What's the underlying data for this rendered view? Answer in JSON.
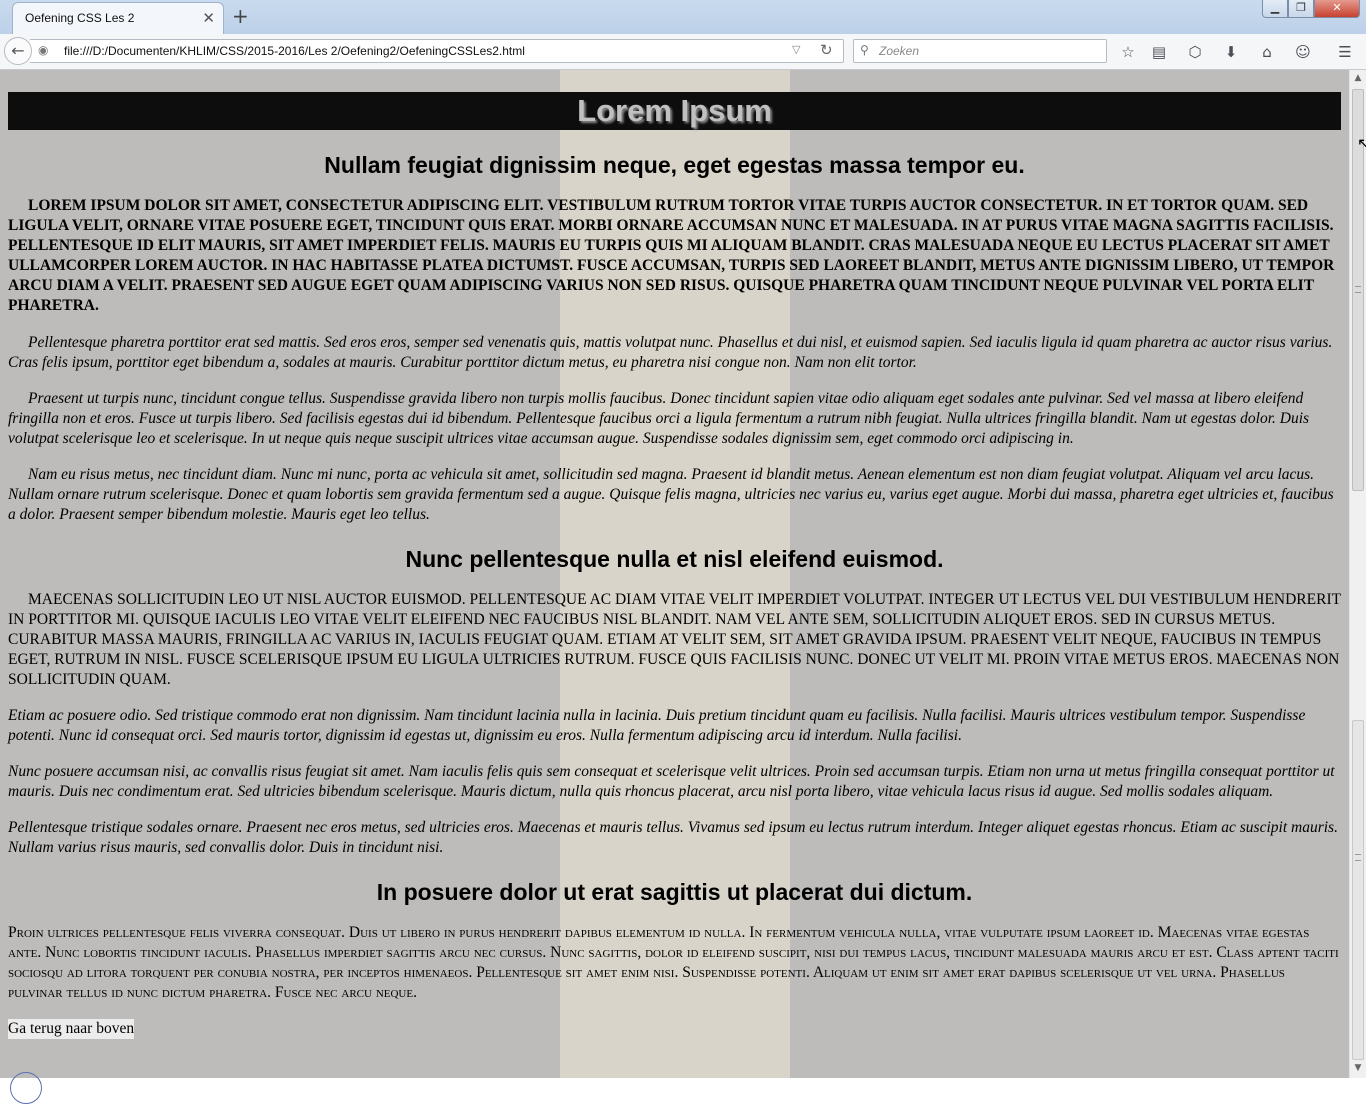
{
  "browser": {
    "tab_title": "Oefening CSS Les 2",
    "tab_close": "✕",
    "new_tab": "+",
    "window_minimize": "▁",
    "window_maximize": "❐",
    "window_close": "✕",
    "back_icon": "←",
    "site_icon": "◉",
    "url": "file:///D:/Documenten/KHLIM/CSS/2015-2016/Les 2/Oefening2/OefeningCSSLes2.html",
    "url_dropdown_icon": "▽",
    "reload_icon": "↻",
    "search_icon": "⚲",
    "search_placeholder": "Zoeken",
    "toolbar_icons": {
      "bookmark": "☆",
      "reading_list": "▤",
      "pocket": "⬡",
      "downloads": "⬇",
      "home": "⌂",
      "chat": "☺",
      "menu": "☰"
    }
  },
  "page": {
    "banner_title": "Lorem Ipsum",
    "section1": {
      "heading": "Nullam feugiat dignissim neque, eget egestas massa tempor eu.",
      "p1": "Lorem ipsum dolor sit amet, consectetur adipiscing elit. Vestibulum rutrum tortor vitae turpis auctor consectetur. In et tortor quam. Sed ligula velit, ornare vitae posuere eget, tincidunt quis erat. Morbi ornare accumsan nunc et malesuada. In at purus vitae magna sagittis facilisis. Pellentesque id elit mauris, sit amet imperdiet felis. Mauris eu turpis quis mi aliquam blandit. Cras malesuada neque eu lectus placerat sit amet ullamcorper lorem auctor. In hac habitasse platea dictumst. Fusce accumsan, turpis sed laoreet blandit, metus ante dignissim libero, ut tempor arcu diam a velit. Praesent sed augue eget quam adipiscing varius non sed risus. Quisque pharetra quam tincidunt neque pulvinar vel porta elit pharetra.",
      "p2": "Pellentesque pharetra porttitor erat sed mattis. Sed eros eros, semper sed venenatis quis, mattis volutpat nunc. Phasellus et dui nisl, et euismod sapien. Sed iaculis ligula id quam pharetra ac auctor risus varius. Cras felis ipsum, porttitor eget bibendum a, sodales at mauris. Curabitur porttitor dictum metus, eu pharetra nisi congue non. Nam non elit tortor.",
      "p3": "Praesent ut turpis nunc, tincidunt congue tellus. Suspendisse gravida libero non turpis mollis faucibus. Donec tincidunt sapien vitae odio aliquam eget sodales ante pulvinar. Sed vel massa at libero eleifend fringilla non et eros. Fusce ut turpis libero. Sed facilisis egestas dui id bibendum. Pellentesque faucibus orci a ligula fermentum a rutrum nibh feugiat. Nulla ultrices fringilla blandit. Nam ut egestas dolor. Duis volutpat scelerisque leo et scelerisque. In ut neque quis neque suscipit ultrices vitae accumsan augue. Suspendisse sodales dignissim sem, eget commodo orci adipiscing in.",
      "p4": "Nam eu risus metus, nec tincidunt diam. Nunc mi nunc, porta ac vehicula sit amet, sollicitudin sed magna. Praesent id blandit metus. Aenean elementum est non diam feugiat volutpat. Aliquam vel arcu lacus. Nullam ornare rutrum scelerisque. Donec et quam lobortis sem gravida fermentum sed a augue. Quisque felis magna, ultricies nec varius eu, varius eget augue. Morbi dui massa, pharetra eget ultricies et, faucibus a dolor. Praesent semper bibendum molestie. Mauris eget leo tellus."
    },
    "section2": {
      "heading": "Nunc pellentesque nulla et nisl eleifend euismod.",
      "p1": "Maecenas sollicitudin leo ut nisl auctor euismod. Pellentesque ac diam vitae velit imperdiet volutpat. Integer ut lectus vel dui vestibulum hendrerit in porttitor mi. Quisque iaculis leo vitae velit eleifend nec faucibus nisl blandit. Nam vel ante sem, sollicitudin aliquet eros. Sed in cursus metus. Curabitur massa mauris, fringilla ac varius in, iaculis feugiat quam. Etiam at velit sem, sit amet gravida ipsum. Praesent velit neque, faucibus in tempus eget, rutrum in nisl. Fusce scelerisque ipsum eu ligula ultricies rutrum. Fusce quis facilisis nunc. Donec ut velit mi. Proin vitae metus eros. Maecenas non sollicitudin quam.",
      "p2": "Etiam ac posuere odio. Sed tristique commodo erat non dignissim. Nam tincidunt lacinia nulla in lacinia. Duis pretium tincidunt quam eu facilisis. Nulla facilisi. Mauris ultrices vestibulum tempor. Suspendisse potenti. Nunc id consequat orci. Sed mauris tortor, dignissim id egestas ut, dignissim eu eros. Nulla fermentum adipiscing arcu id interdum. Nulla facilisi.",
      "p3": "Nunc posuere accumsan nisi, ac convallis risus feugiat sit amet. Nam iaculis felis quis sem consequat et scelerisque velit ultrices. Proin sed accumsan turpis. Etiam non urna ut metus fringilla consequat porttitor ut mauris. Duis nec condimentum erat. Sed ultricies bibendum scelerisque. Mauris dictum, nulla quis rhoncus placerat, arcu nisl porta libero, vitae vehicula lacus risus id augue. Sed mollis sodales aliquam.",
      "p4": "Pellentesque tristique sodales ornare. Praesent nec eros metus, sed ultricies eros. Maecenas et mauris tellus. Vivamus sed ipsum eu lectus rutrum interdum. Integer aliquet egestas rhoncus. Etiam ac suscipit mauris. Nullam varius risus mauris, sed convallis dolor. Duis in tincidunt nisi."
    },
    "section3": {
      "heading": "In posuere dolor ut erat sagittis ut placerat dui dictum.",
      "p1": "Proin ultrices pellentesque felis viverra consequat. Duis ut libero in purus hendrerit dapibus elementum id nulla. In fermentum vehicula nulla, vitae vulputate ipsum laoreet id. Maecenas vitae egestas ante. Nunc lobortis tincidunt iaculis. Phasellus imperdiet sagittis arcu nec cursus. Nunc sagittis, dolor id eleifend suscipit, nisi dui tempus lacus, tincidunt malesuada mauris arcu et est. Class aptent taciti sociosqu ad litora torquent per conubia nostra, per inceptos himenaeos. Pellentesque sit amet enim nisi. Suspendisse potenti. Aliquam ut enim sit amet erat dapibus scelerisque ut vel urna. Phasellus pulvinar tellus id nunc dictum pharetra. Fusce nec arcu neque."
    },
    "back_to_top": "Ga terug naar boven"
  },
  "scrollbar": {
    "up_arrow": "▲",
    "down_arrow": "▼"
  },
  "colors": {
    "page_background": "#bdbcbb",
    "center_stripe": "#d8d4c9",
    "banner_background": "#0d0d0d",
    "banner_text": "#c0c0c0"
  }
}
